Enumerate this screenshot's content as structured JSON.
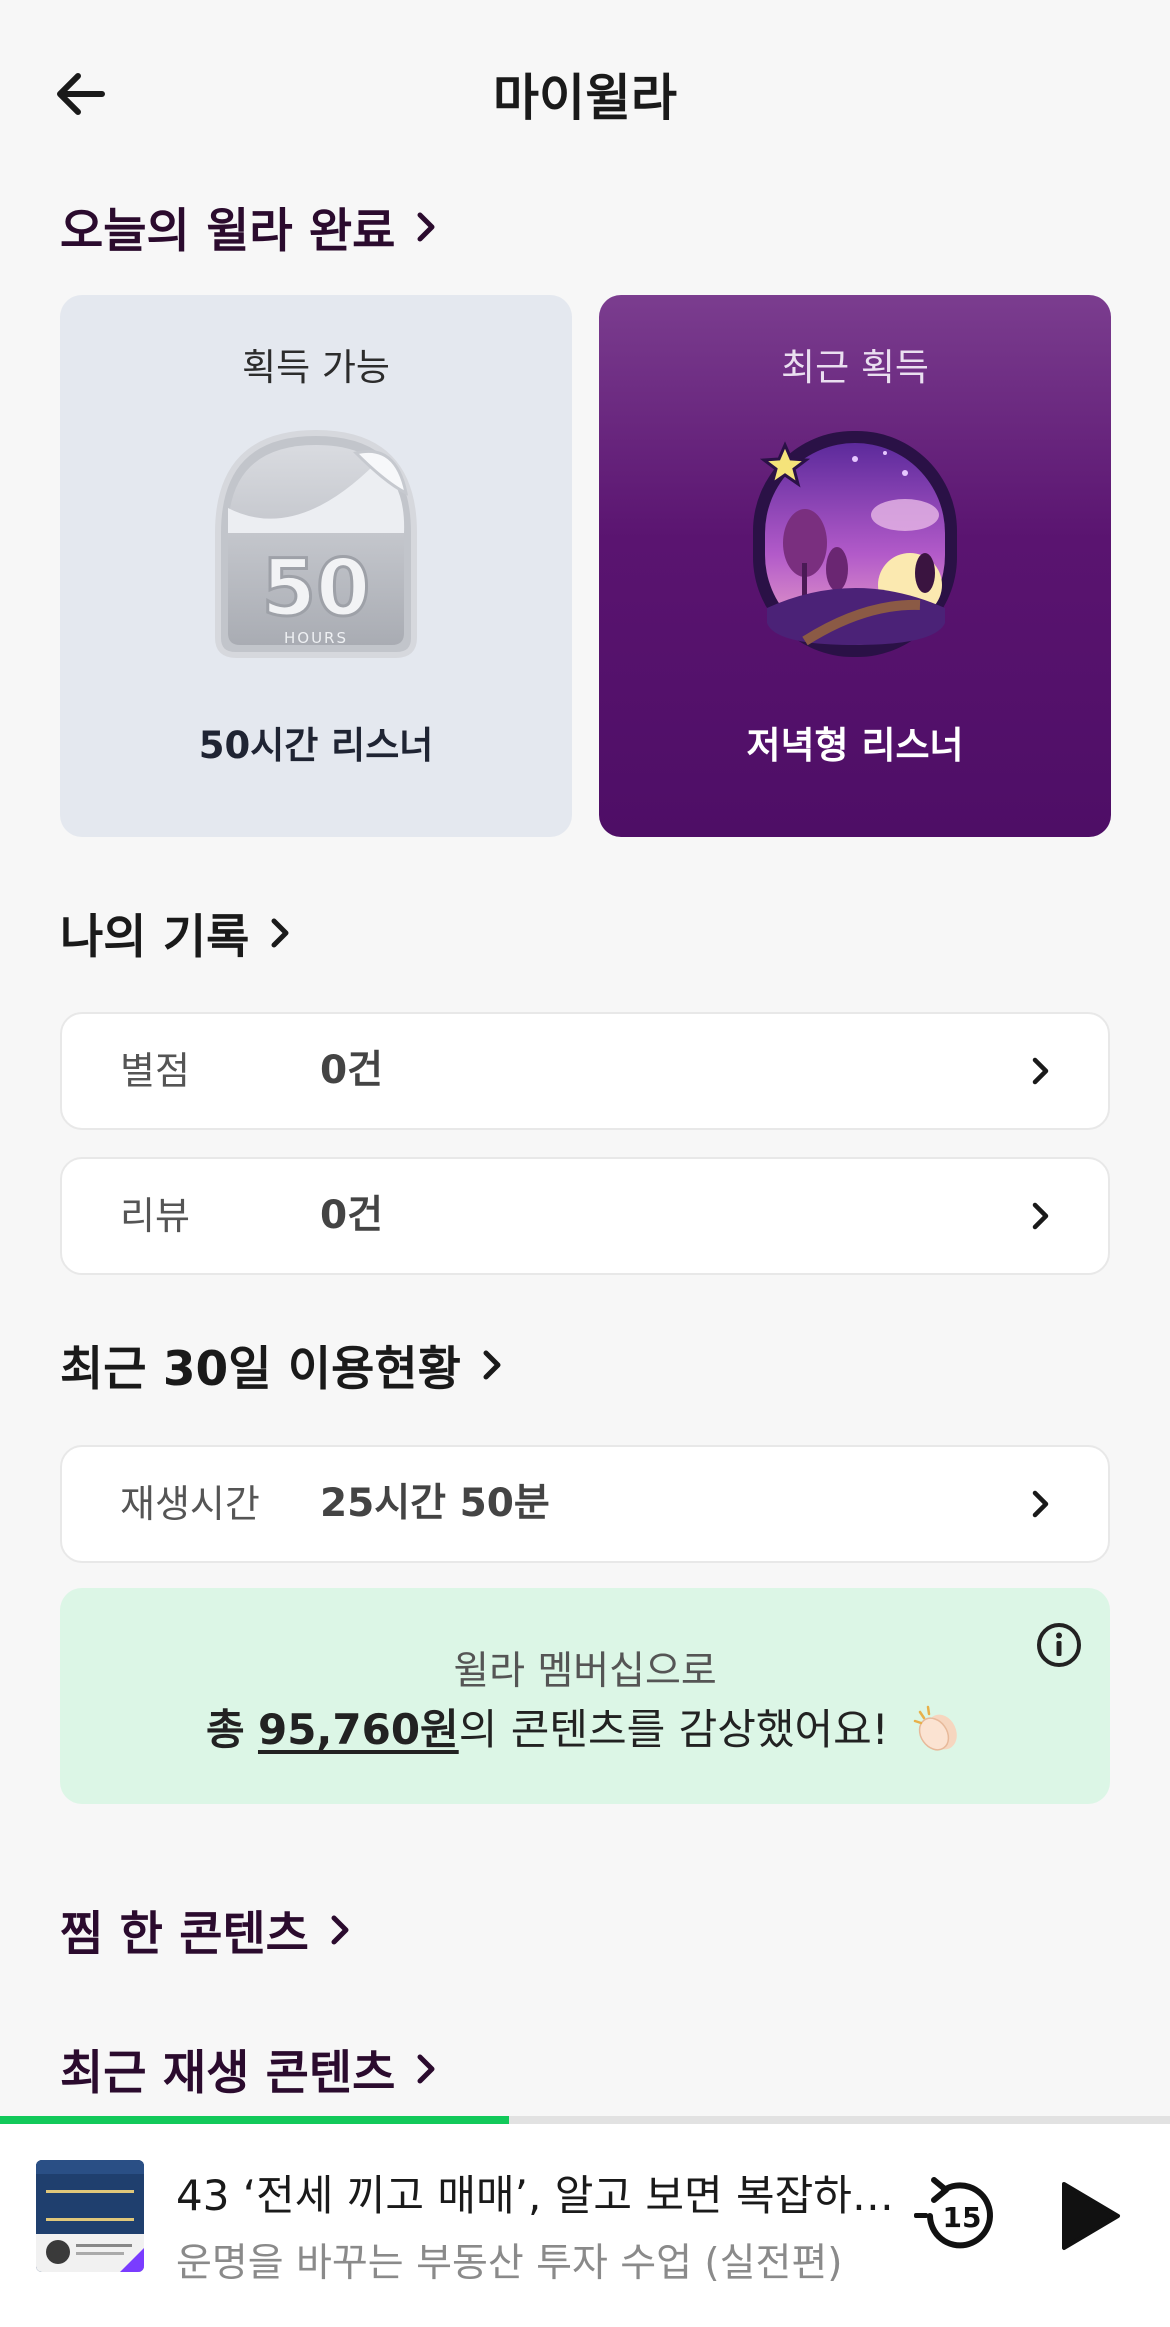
{
  "header": {
    "title": "마이윌라"
  },
  "sections": {
    "today": "오늘의 윌라 완료",
    "records": "나의 기록",
    "usage": "최근 30일 이용현황",
    "wishlist": "찜 한 콘텐츠",
    "recent_play": "최근 재생 콘텐츠"
  },
  "badges": {
    "available": {
      "caption": "획득 가능",
      "name": "50시간 리스너",
      "emblem_number": "50",
      "emblem_unit": "HOURS"
    },
    "recent": {
      "caption": "최근 획득",
      "name": "저녁형 리스너"
    }
  },
  "records": [
    {
      "label": "별점",
      "value": "0건"
    },
    {
      "label": "리뷰",
      "value": "0건"
    }
  ],
  "usage": {
    "label": "재생시간",
    "value": "25시간 50분"
  },
  "saving": {
    "line1": "윌라 멤버십으로",
    "prefix": "총",
    "amount": "95,760원",
    "suffix": "의 콘텐츠를 감상했어요!"
  },
  "player": {
    "title": "43 ‘전세 끼고 매매’, 알고 보면 복잡하…",
    "subtitle": "운명을 바꾸는 부동산 투자 수업 (실전편)",
    "cover_text": "부동산 투자 수업",
    "rewind_seconds": "15",
    "progress": 0.435
  },
  "colors": {
    "section_title": "#2b0b2e",
    "recent_badge_bg": "#5a1470",
    "available_badge_bg": "#e4e8ef",
    "saving_bg": "#dcf6e6",
    "progress": "#12c95a"
  }
}
